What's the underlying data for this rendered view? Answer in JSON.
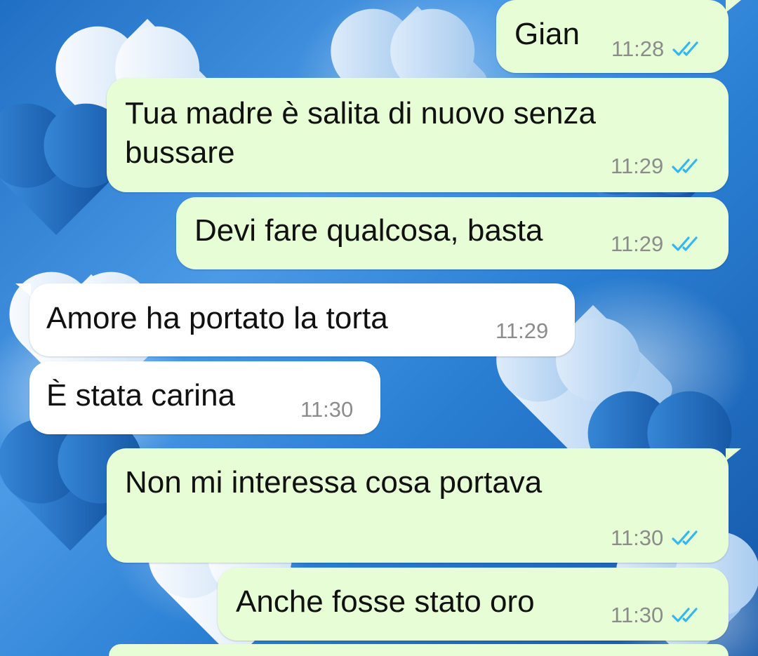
{
  "wallpaper": {
    "theme": "blue-and-white-hearts"
  },
  "colors": {
    "outgoing_bubble": "#e7fdd6",
    "incoming_bubble": "#ffffff",
    "read_ticks": "#34b7f1",
    "timestamp": "#8c8c8c"
  },
  "messages": [
    {
      "direction": "outgoing",
      "text": "Gian",
      "time": "11:28",
      "status": "read"
    },
    {
      "direction": "outgoing",
      "text_lines": [
        "Tua madre è salita di nuovo senza",
        "bussare"
      ],
      "time": "11:29",
      "status": "read"
    },
    {
      "direction": "outgoing",
      "text": "Devi fare qualcosa, basta",
      "time": "11:29",
      "status": "read"
    },
    {
      "direction": "incoming",
      "text": "Amore ha portato la torta",
      "time": "11:29"
    },
    {
      "direction": "incoming",
      "text": "È stata carina",
      "time": "11:30"
    },
    {
      "direction": "outgoing",
      "text": "Non mi interessa cosa portava",
      "time": "11:30",
      "status": "read"
    },
    {
      "direction": "outgoing",
      "text": "Anche fosse stato oro",
      "time": "11:30",
      "status": "read"
    }
  ]
}
